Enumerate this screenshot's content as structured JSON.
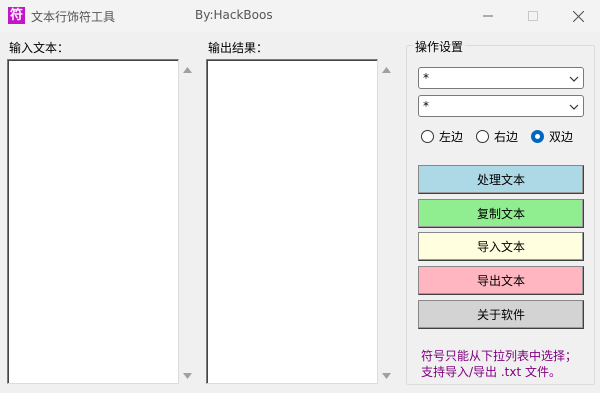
{
  "window": {
    "title": "文本行饰符工具",
    "icon_char": "符",
    "author": "By:HackBoos",
    "icon_color": "#c214c9"
  },
  "labels": {
    "input": "输入文本：",
    "output": "输出结果："
  },
  "input_text": "",
  "output_text": "",
  "settings": {
    "group_title": "操作设置",
    "symbol_1": "*",
    "symbol_2": "*",
    "radios": [
      {
        "label": "左边",
        "checked": false
      },
      {
        "label": "右边",
        "checked": false
      },
      {
        "label": "双边",
        "checked": true
      }
    ]
  },
  "buttons": {
    "process": {
      "label": "处理文本",
      "color": "#add8e6"
    },
    "copy": {
      "label": "复制文本",
      "color": "#90ee90"
    },
    "import": {
      "label": "导入文本",
      "color": "#ffffe0"
    },
    "export": {
      "label": "导出文本",
      "color": "#ffb6c1"
    },
    "about": {
      "label": "关于软件",
      "color": "#d3d3d3"
    }
  },
  "hint": {
    "line1": "符号只能从下拉列表中选择；",
    "line2": "支持导入/导出 .txt 文件。",
    "color": "#800080"
  }
}
